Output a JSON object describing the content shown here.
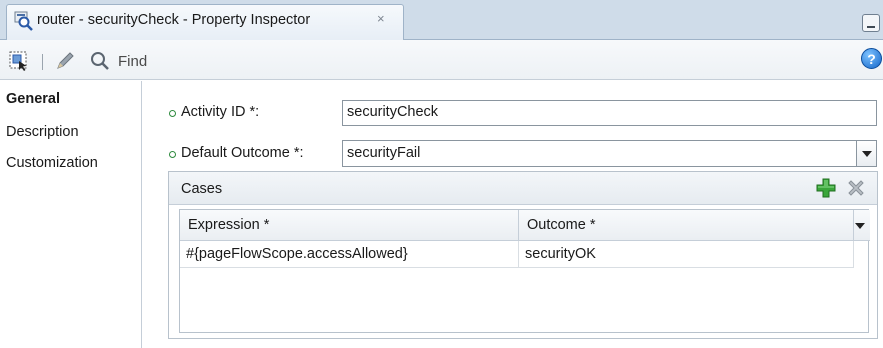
{
  "tab": {
    "title": "router - securityCheck - Property Inspector",
    "close_glyph": "×"
  },
  "toolbar": {
    "search_placeholder": "Find",
    "help_glyph": "?"
  },
  "nav": {
    "items": [
      {
        "label": "General",
        "active": true
      },
      {
        "label": "Description",
        "active": false
      },
      {
        "label": "Customization",
        "active": false
      }
    ]
  },
  "form": {
    "activity_id": {
      "label": "Activity ID *:",
      "value": "securityCheck"
    },
    "default_outcome": {
      "label": "Default Outcome *:",
      "value": "securityFail"
    }
  },
  "cases": {
    "title": "Cases",
    "columns": [
      "Expression *",
      "Outcome *"
    ],
    "rows": [
      {
        "expression": "#{pageFlowScope.accessAllowed}",
        "outcome": "securityOK"
      }
    ]
  },
  "icons": {
    "tab": "router-icon",
    "select_tool": "select-tool-icon",
    "edit": "pencil-icon",
    "search": "search-icon",
    "help": "help-icon",
    "add": "add-icon",
    "remove": "remove-icon"
  },
  "colors": {
    "tabstrip": "#cfdce9",
    "required_dot": "#2e8a3e",
    "add_green": "#3aa63a",
    "help_blue": "#1466c9"
  }
}
